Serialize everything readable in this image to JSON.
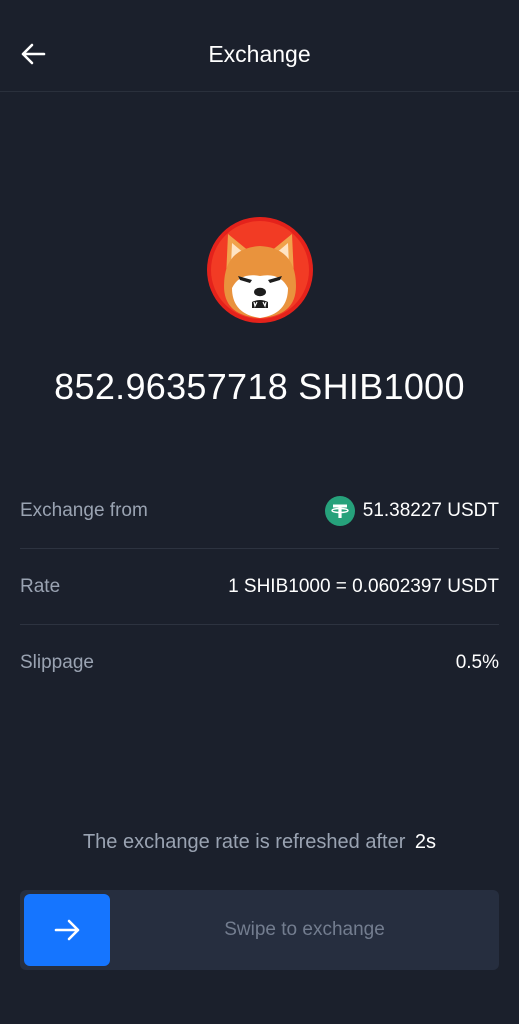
{
  "header": {
    "title": "Exchange",
    "back_icon": "arrow-left-icon"
  },
  "token": {
    "logo_icon": "shiba-inu-logo-icon",
    "amount": "852.96357718 SHIB1000"
  },
  "details": {
    "exchange_from_label": "Exchange from",
    "exchange_from_icon": "usdt-tether-icon",
    "exchange_from_value": "51.38227 USDT",
    "rate_label": "Rate",
    "rate_value": "1 SHIB1000 = 0.0602397 USDT",
    "slippage_label": "Slippage",
    "slippage_value": "0.5%"
  },
  "refresh": {
    "text": "The exchange rate is refreshed after",
    "seconds": "2s"
  },
  "swipe": {
    "label": "Swipe to exchange",
    "handle_icon": "arrow-right-icon",
    "accent_color": "#1575ff"
  },
  "colors": {
    "background": "#1b202c",
    "secondary_text": "#9aa3b2",
    "usdt_green": "#26a17b"
  }
}
